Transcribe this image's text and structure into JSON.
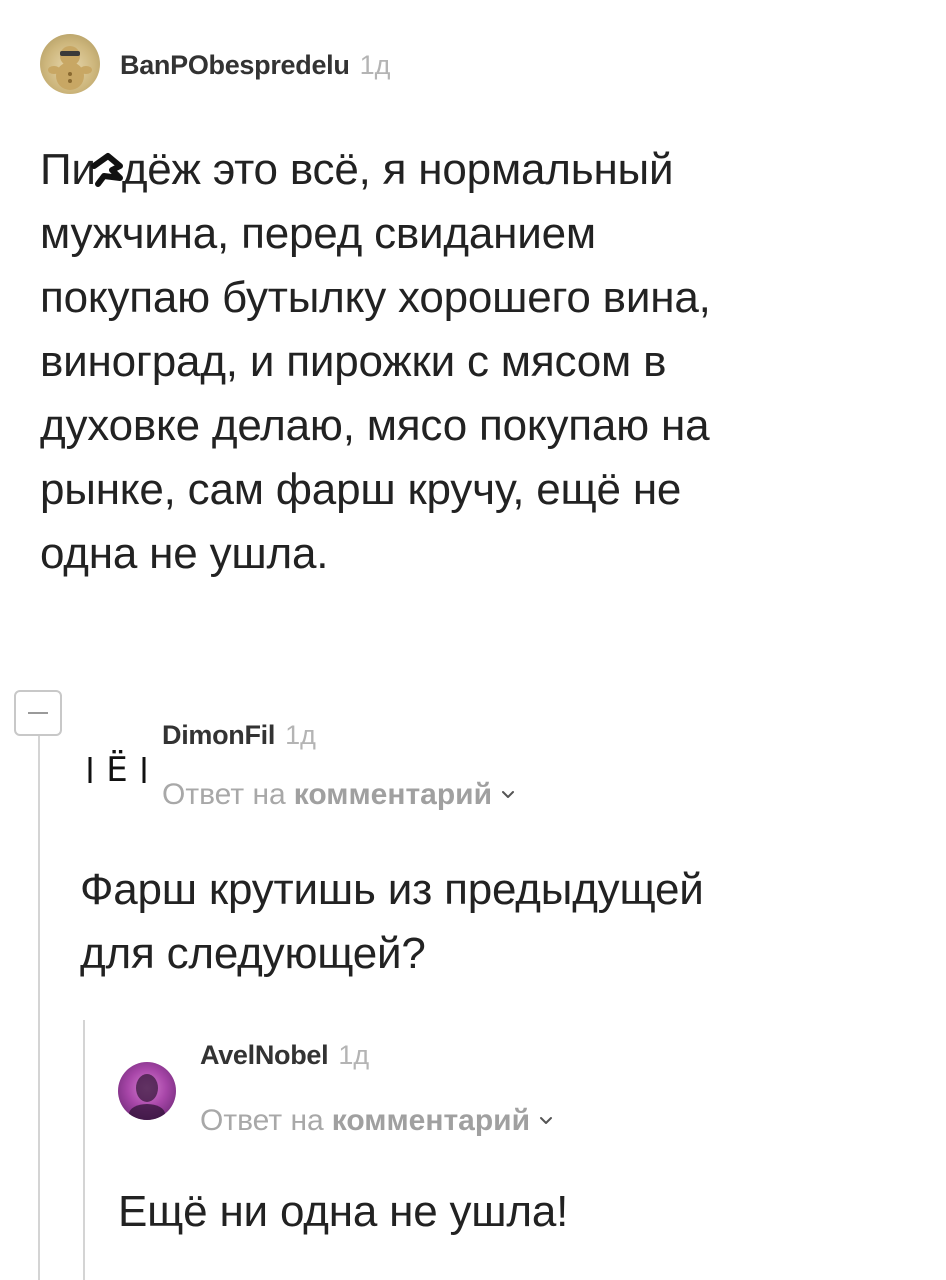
{
  "comments": [
    {
      "username": "BanPObespredelu",
      "time": "1д",
      "body_start": "Пи",
      "body_rest": "дёж это всё, я нормальный\nмужчина, перед свиданием\nпокупаю бутылку хорошего вина,\nвиноград, и пирожки с мясом в\nдуховке делаю, мясо покупаю на\nрынке, сам фарш кручу, ещё не\nодна не ушла."
    },
    {
      "username": "DimonFil",
      "time": "1д",
      "avatar_letter": "Ё",
      "reply_prefix": "Ответ на",
      "reply_target": "комментарий",
      "body": "Фарш крутишь из предыдущей\nдля следующей?"
    },
    {
      "username": "AvelNobel",
      "time": "1д",
      "reply_prefix": "Ответ на",
      "reply_target": "комментарий",
      "body": "Ещё ни одна не ушла!"
    }
  ],
  "icons": {
    "collapse": "minus-icon",
    "reply_expand": "chevron-down-icon"
  },
  "colors": {
    "text": "#222222",
    "muted": "#a8a8a8",
    "thread_line": "#d4d4d4"
  }
}
